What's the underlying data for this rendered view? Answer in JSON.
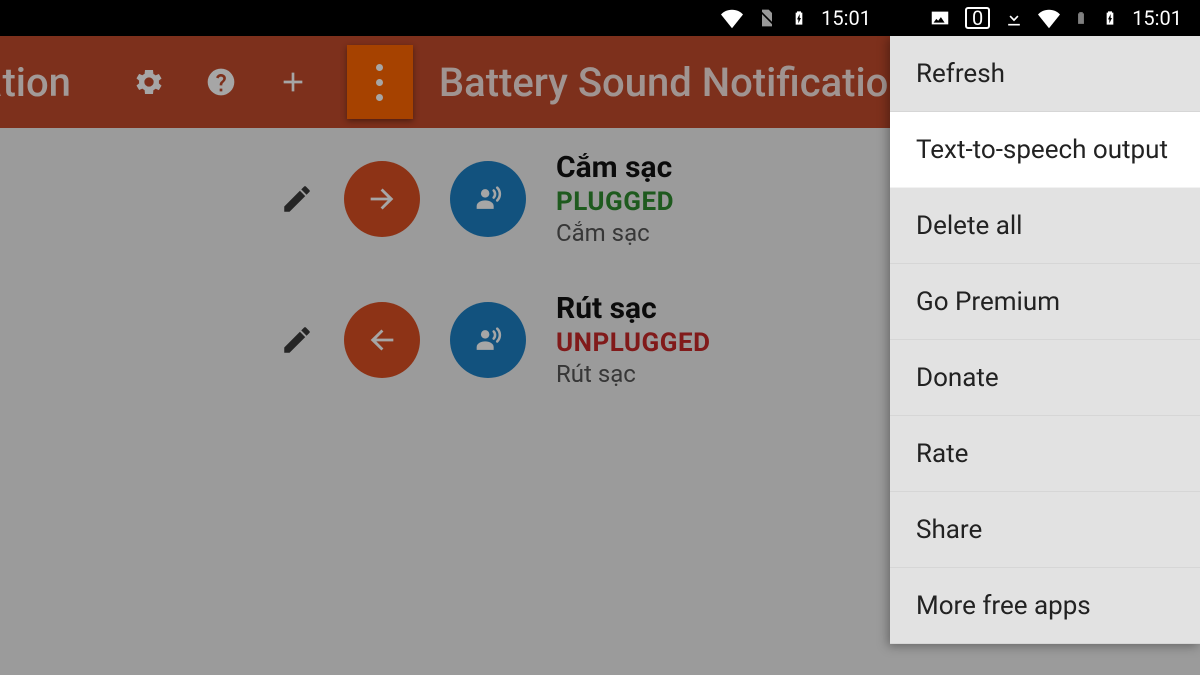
{
  "statusbar": {
    "time": "15:01",
    "battery_label": "0",
    "time2": "15:01"
  },
  "actionbar": {
    "title_left": "cation",
    "title_right": "Battery Sound Notification"
  },
  "list": [
    {
      "title": "Cắm sạc",
      "status": "PLUGGED",
      "status_class": "status-green",
      "subtitle": "Cắm sạc",
      "arrow": "right"
    },
    {
      "title": "Rút sạc",
      "status": "UNPLUGGED",
      "status_class": "status-red",
      "subtitle": "Rút sạc",
      "arrow": "left"
    }
  ],
  "menu": {
    "items": [
      {
        "label": "Refresh",
        "highlight": false,
        "name": "menu-refresh"
      },
      {
        "label": "Text-to-speech output",
        "highlight": true,
        "name": "menu-tts"
      },
      {
        "label": "Delete all",
        "highlight": false,
        "name": "menu-delete-all"
      },
      {
        "label": "Go Premium",
        "highlight": false,
        "name": "menu-premium"
      },
      {
        "label": "Donate",
        "highlight": false,
        "name": "menu-donate"
      },
      {
        "label": "Rate",
        "highlight": false,
        "name": "menu-rate"
      },
      {
        "label": "Share",
        "highlight": false,
        "name": "menu-share"
      },
      {
        "label": "More free apps",
        "highlight": false,
        "name": "menu-more-apps"
      }
    ]
  }
}
